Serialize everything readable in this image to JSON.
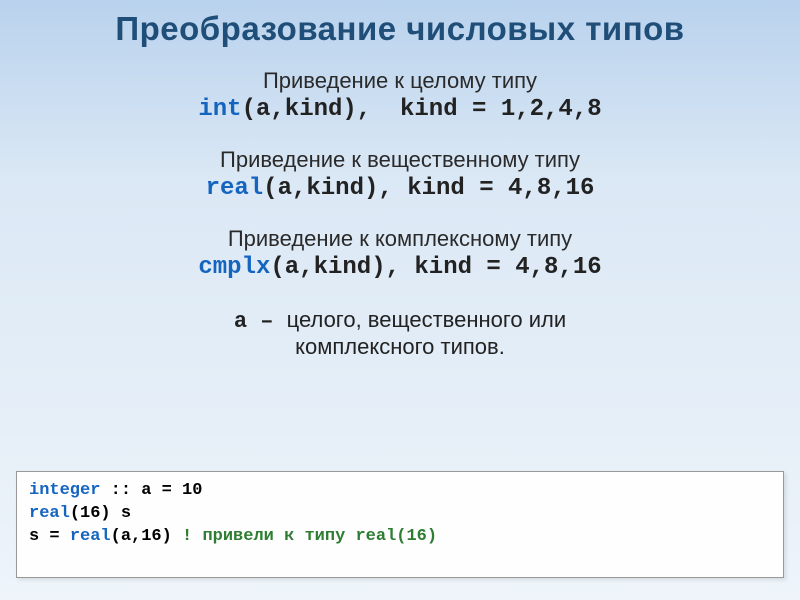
{
  "title": "Преобразование числовых типов",
  "int_section": {
    "label": "Приведение к целому типу",
    "keyword": "int",
    "rest": "(a,kind),  kind = 1,2,4,8"
  },
  "real_section": {
    "label": "Приведение к вещественному типу",
    "keyword": "real",
    "rest": "(a,kind), kind = 4,8,16"
  },
  "cmplx_section": {
    "label": "Приведение к комплексному типу",
    "keyword": "cmplx",
    "rest": "(a,kind), kind = 4,8,16"
  },
  "footnote": {
    "var": "a",
    "dash": " – ",
    "text1": "целого, вещественного или",
    "text2": "комплексного типов."
  },
  "codebox": {
    "line1_kw": "integer",
    "line1_rest": " :: a = 10",
    "line2_kw": "real",
    "line2_rest": "(16) s",
    "line3_indent": "  s = ",
    "line3_kw": "real",
    "line3_rest": "(a,16) ",
    "line3_comment": "! привели к типу real(16)"
  }
}
